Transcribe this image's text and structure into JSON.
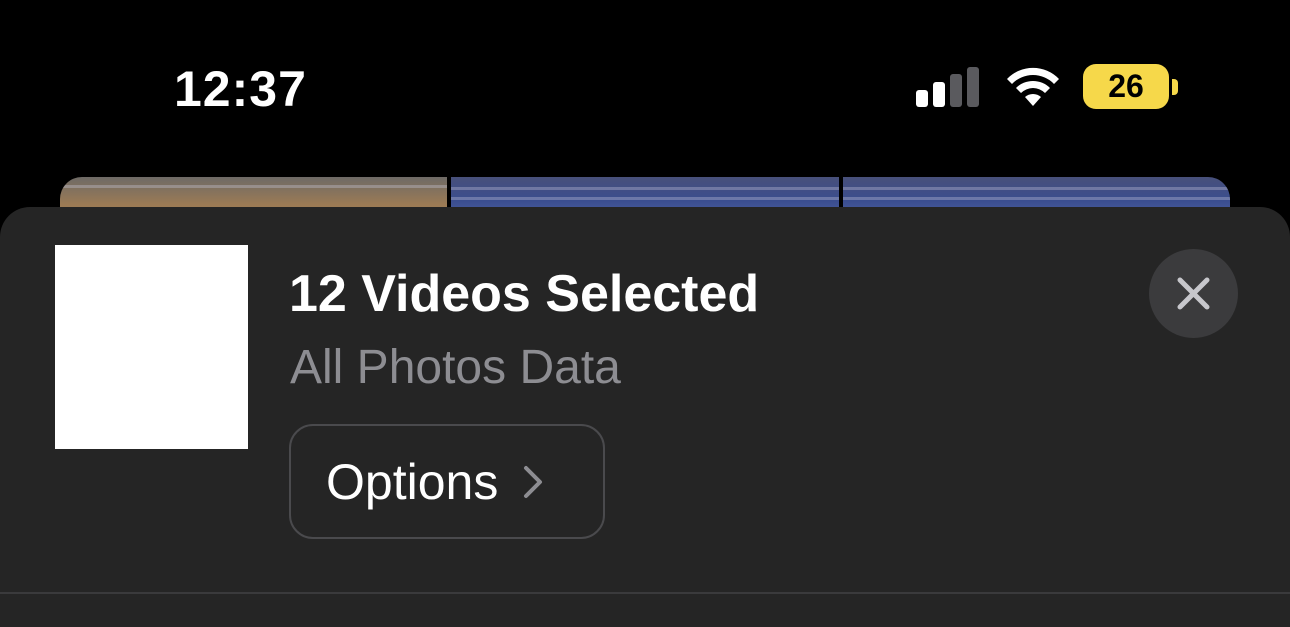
{
  "status_bar": {
    "time": "12:37",
    "signal_strength": 0.5,
    "wifi_icon": "wifi-icon",
    "battery_level": "26",
    "battery_color": "#f6d84a"
  },
  "background": {
    "photo_strip_icon": "photo-thumbnails"
  },
  "sheet": {
    "title": "12 Videos Selected",
    "subtitle": "All Photos Data",
    "options_label": "Options",
    "options_icon": "chevron-right-icon",
    "close_icon": "close-icon",
    "preview_icon": "preview-thumbnail"
  },
  "colors": {
    "sheet_background": "#252525",
    "subtitle_gray": "#8d8d92",
    "close_button_bg": "#3b3b3d"
  }
}
